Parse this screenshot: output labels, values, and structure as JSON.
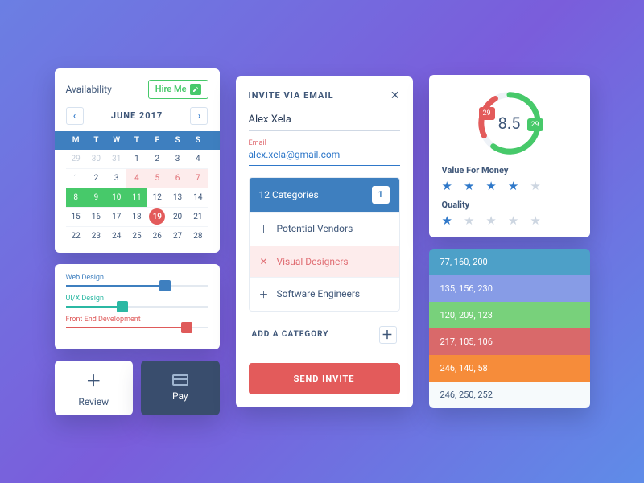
{
  "calendar": {
    "title": "Availability",
    "hire_label": "Hire Me",
    "month": "JUNE 2017",
    "dow": [
      "M",
      "T",
      "W",
      "T",
      "F",
      "S",
      "S"
    ],
    "cells": [
      {
        "n": "29",
        "cls": "mute"
      },
      {
        "n": "30",
        "cls": "mute"
      },
      {
        "n": "31",
        "cls": "mute"
      },
      {
        "n": "1"
      },
      {
        "n": "2"
      },
      {
        "n": "3"
      },
      {
        "n": "4"
      },
      {
        "n": "1"
      },
      {
        "n": "2"
      },
      {
        "n": "3"
      },
      {
        "n": "4",
        "cls": "pink"
      },
      {
        "n": "5",
        "cls": "pink"
      },
      {
        "n": "6",
        "cls": "pink"
      },
      {
        "n": "7",
        "cls": "pink"
      },
      {
        "n": "8",
        "cls": "sel"
      },
      {
        "n": "9",
        "cls": "sel"
      },
      {
        "n": "10",
        "cls": "sel"
      },
      {
        "n": "11",
        "cls": "sel"
      },
      {
        "n": "12"
      },
      {
        "n": "13"
      },
      {
        "n": "14"
      },
      {
        "n": "15"
      },
      {
        "n": "16"
      },
      {
        "n": "17"
      },
      {
        "n": "18"
      },
      {
        "n": "19",
        "cls": "dot"
      },
      {
        "n": "20"
      },
      {
        "n": "21"
      },
      {
        "n": "22"
      },
      {
        "n": "23"
      },
      {
        "n": "24"
      },
      {
        "n": "25"
      },
      {
        "n": "26"
      },
      {
        "n": "27"
      },
      {
        "n": "28"
      }
    ]
  },
  "sliders": [
    {
      "label": "Web Design",
      "pct": 70,
      "tone": "blue",
      "val": "3"
    },
    {
      "label": "UI/X Design",
      "pct": 40,
      "tone": "teal",
      "val": "2"
    },
    {
      "label": "Front End Development",
      "pct": 85,
      "tone": "red",
      "val": "4"
    }
  ],
  "actions": {
    "review": "Review",
    "pay": "Pay"
  },
  "invite": {
    "title": "INVITE VIA EMAIL",
    "name": "Alex Xela",
    "email_label": "Email",
    "email": "alex.xela@gmail.com",
    "cat_head": "12 Categories",
    "badge": "1",
    "categories": [
      {
        "label": "Potential Vendors",
        "state": ""
      },
      {
        "label": "Visual Designers",
        "state": "sel"
      },
      {
        "label": "Software Engineers",
        "state": ""
      }
    ],
    "add_label": "ADD A CATEGORY",
    "send": "SEND INVITE"
  },
  "rating": {
    "score": "8.5",
    "red": "29",
    "green": "29",
    "rows": [
      {
        "label": "Value For Money",
        "stars": [
          true,
          true,
          true,
          true,
          false
        ]
      },
      {
        "label": "Quality",
        "stars": [
          true,
          false,
          false,
          false,
          false
        ]
      }
    ]
  },
  "swatches": [
    {
      "rgb": "77, 160, 200",
      "bg": "#4da0c8"
    },
    {
      "rgb": "135, 156, 230",
      "bg": "#879ce6"
    },
    {
      "rgb": "120, 209, 123",
      "bg": "#78d17b"
    },
    {
      "rgb": "217, 105, 106",
      "bg": "#d9696a"
    },
    {
      "rgb": "246, 140, 58",
      "bg": "#f68c3a"
    },
    {
      "rgb": "246, 250, 252",
      "bg": "#f6fafc",
      "dark": true
    }
  ]
}
